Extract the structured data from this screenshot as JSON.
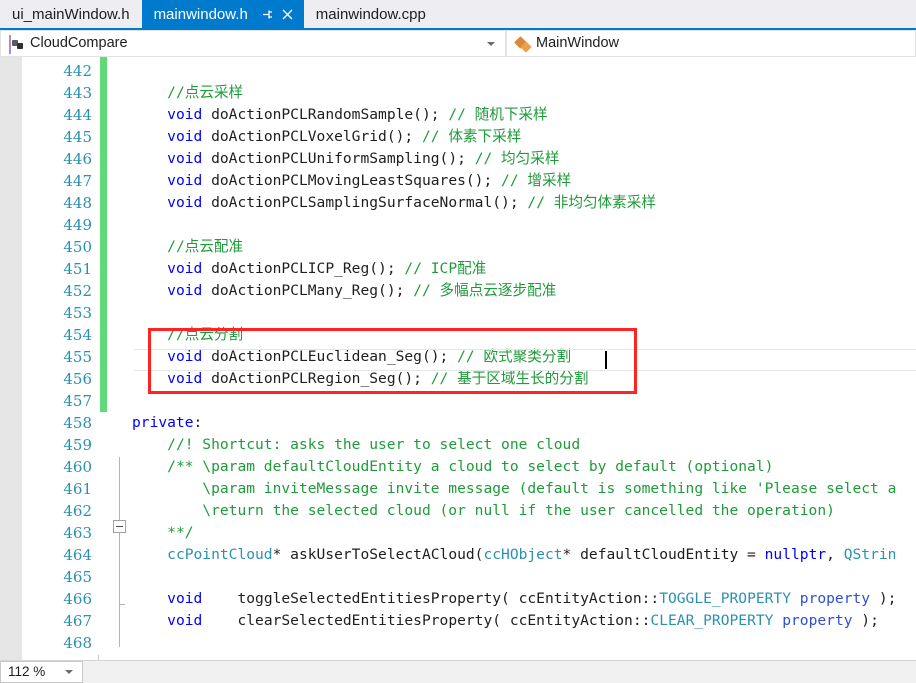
{
  "window": {
    "tabs": [
      {
        "label": "ui_mainWindow.h",
        "active": false,
        "name": "tab-ui-mainwindow-h"
      },
      {
        "label": "mainwindow.h",
        "active": true,
        "name": "tab-mainwindow-h",
        "pin_icon": "pin-icon",
        "close_icon": "close-icon"
      },
      {
        "label": "mainwindow.cpp",
        "active": false,
        "name": "tab-mainwindow-cpp"
      }
    ]
  },
  "navbar": {
    "project_selector": {
      "value": "CloudCompare",
      "icon": "project-file-icon",
      "dropdown_icon": "chevron-down-icon"
    },
    "member_selector": {
      "value": "MainWindow",
      "icon": "class-icon"
    }
  },
  "statusbar": {
    "zoom": {
      "value": "112 %",
      "dropdown_icon": "chevron-down-icon"
    }
  },
  "colors": {
    "tab_active_bg": "#007acc",
    "accent_underline": "#007acc",
    "keyword": "#0000ff",
    "comment": "#1f9b3a",
    "type": "#2b91af",
    "linenumber": "#2b91af",
    "change_bar": "#60d978",
    "highlight_box": "#ff2323",
    "chrome_bg": "#eeeef2",
    "margin_bg": "#e6e6e6"
  },
  "editor": {
    "first_line": 442,
    "last_line": 468,
    "current_line": 455,
    "highlight_box_lines": [
      454,
      456
    ],
    "lines": [
      {
        "n": 442,
        "tokens": []
      },
      {
        "n": 443,
        "tokens": [
          {
            "t": "    ",
            "c": "plain"
          },
          {
            "t": "//点云采样",
            "c": "cmt"
          }
        ]
      },
      {
        "n": 444,
        "tokens": [
          {
            "t": "    ",
            "c": "plain"
          },
          {
            "t": "void",
            "c": "kw"
          },
          {
            "t": " doActionPCLRandomSample(); ",
            "c": "plain"
          },
          {
            "t": "// 随机下采样",
            "c": "cmt"
          }
        ]
      },
      {
        "n": 445,
        "tokens": [
          {
            "t": "    ",
            "c": "plain"
          },
          {
            "t": "void",
            "c": "kw"
          },
          {
            "t": " doActionPCLVoxelGrid(); ",
            "c": "plain"
          },
          {
            "t": "// 体素下采样",
            "c": "cmt"
          }
        ]
      },
      {
        "n": 446,
        "tokens": [
          {
            "t": "    ",
            "c": "plain"
          },
          {
            "t": "void",
            "c": "kw"
          },
          {
            "t": " doActionPCLUniformSampling(); ",
            "c": "plain"
          },
          {
            "t": "// 均匀采样",
            "c": "cmt"
          }
        ]
      },
      {
        "n": 447,
        "tokens": [
          {
            "t": "    ",
            "c": "plain"
          },
          {
            "t": "void",
            "c": "kw"
          },
          {
            "t": " doActionPCLMovingLeastSquares(); ",
            "c": "plain"
          },
          {
            "t": "// 增采样",
            "c": "cmt"
          }
        ]
      },
      {
        "n": 448,
        "tokens": [
          {
            "t": "    ",
            "c": "plain"
          },
          {
            "t": "void",
            "c": "kw"
          },
          {
            "t": " doActionPCLSamplingSurfaceNormal(); ",
            "c": "plain"
          },
          {
            "t": "// 非均匀体素采样",
            "c": "cmt"
          }
        ]
      },
      {
        "n": 449,
        "tokens": []
      },
      {
        "n": 450,
        "tokens": [
          {
            "t": "    ",
            "c": "plain"
          },
          {
            "t": "//点云配准",
            "c": "cmt"
          }
        ]
      },
      {
        "n": 451,
        "tokens": [
          {
            "t": "    ",
            "c": "plain"
          },
          {
            "t": "void",
            "c": "kw"
          },
          {
            "t": " doActionPCLICP_Reg(); ",
            "c": "plain"
          },
          {
            "t": "// ICP配准",
            "c": "cmt"
          }
        ]
      },
      {
        "n": 452,
        "tokens": [
          {
            "t": "    ",
            "c": "plain"
          },
          {
            "t": "void",
            "c": "kw"
          },
          {
            "t": " doActionPCLMany_Reg(); ",
            "c": "plain"
          },
          {
            "t": "// 多幅点云逐步配准",
            "c": "cmt"
          }
        ]
      },
      {
        "n": 453,
        "tokens": []
      },
      {
        "n": 454,
        "tokens": [
          {
            "t": "    ",
            "c": "plain"
          },
          {
            "t": "//点云分割",
            "c": "cmt"
          }
        ]
      },
      {
        "n": 455,
        "tokens": [
          {
            "t": "    ",
            "c": "plain"
          },
          {
            "t": "void",
            "c": "kw"
          },
          {
            "t": " doActionPCLEuclidean_Seg(); ",
            "c": "plain"
          },
          {
            "t": "// 欧式聚类分割",
            "c": "cmt"
          }
        ]
      },
      {
        "n": 456,
        "tokens": [
          {
            "t": "    ",
            "c": "plain"
          },
          {
            "t": "void",
            "c": "kw"
          },
          {
            "t": " doActionPCLRegion_Seg(); ",
            "c": "plain"
          },
          {
            "t": "// 基于区域生长的分割",
            "c": "cmt"
          }
        ]
      },
      {
        "n": 457,
        "tokens": []
      },
      {
        "n": 458,
        "tokens": [
          {
            "t": "private",
            "c": "kw"
          },
          {
            "t": ":",
            "c": "plain"
          }
        ]
      },
      {
        "n": 459,
        "tokens": [
          {
            "t": "    ",
            "c": "plain"
          },
          {
            "t": "//! Shortcut: asks the user to select one cloud",
            "c": "cmt"
          }
        ]
      },
      {
        "n": 460,
        "tokens": [
          {
            "t": "    ",
            "c": "plain"
          },
          {
            "t": "/** \\param defaultCloudEntity a cloud to select by default (optional)",
            "c": "cmt"
          }
        ]
      },
      {
        "n": 461,
        "tokens": [
          {
            "t": "        ",
            "c": "plain"
          },
          {
            "t": "\\param inviteMessage invite message (default is something like 'Please select a",
            "c": "cmt"
          }
        ]
      },
      {
        "n": 462,
        "tokens": [
          {
            "t": "        ",
            "c": "plain"
          },
          {
            "t": "\\return the selected cloud (or null if the user cancelled the operation)",
            "c": "cmt"
          }
        ]
      },
      {
        "n": 463,
        "tokens": [
          {
            "t": "    ",
            "c": "plain"
          },
          {
            "t": "**/",
            "c": "cmt"
          }
        ]
      },
      {
        "n": 464,
        "tokens": [
          {
            "t": "    ",
            "c": "plain"
          },
          {
            "t": "ccPointCloud",
            "c": "type"
          },
          {
            "t": "* askUserToSelectACloud(",
            "c": "plain"
          },
          {
            "t": "ccHObject",
            "c": "type"
          },
          {
            "t": "* defaultCloudEntity = ",
            "c": "plain"
          },
          {
            "t": "nullptr",
            "c": "kw"
          },
          {
            "t": ", ",
            "c": "plain"
          },
          {
            "t": "QStrin",
            "c": "type"
          }
        ]
      },
      {
        "n": 465,
        "tokens": []
      },
      {
        "n": 466,
        "tokens": [
          {
            "t": "    ",
            "c": "plain"
          },
          {
            "t": "void",
            "c": "kw"
          },
          {
            "t": "    toggleSelectedEntitiesProperty( ccEntityAction::",
            "c": "plain"
          },
          {
            "t": "TOGGLE_PROPERTY",
            "c": "type"
          },
          {
            "t": " property",
            "c": "param"
          },
          {
            "t": " );",
            "c": "plain"
          }
        ]
      },
      {
        "n": 467,
        "tokens": [
          {
            "t": "    ",
            "c": "plain"
          },
          {
            "t": "void",
            "c": "kw"
          },
          {
            "t": "    clearSelectedEntitiesProperty( ccEntityAction::",
            "c": "plain"
          },
          {
            "t": "CLEAR_PROPERTY",
            "c": "type"
          },
          {
            "t": " property",
            "c": "param"
          },
          {
            "t": " );",
            "c": "plain"
          }
        ]
      },
      {
        "n": 468,
        "tokens": []
      }
    ]
  }
}
